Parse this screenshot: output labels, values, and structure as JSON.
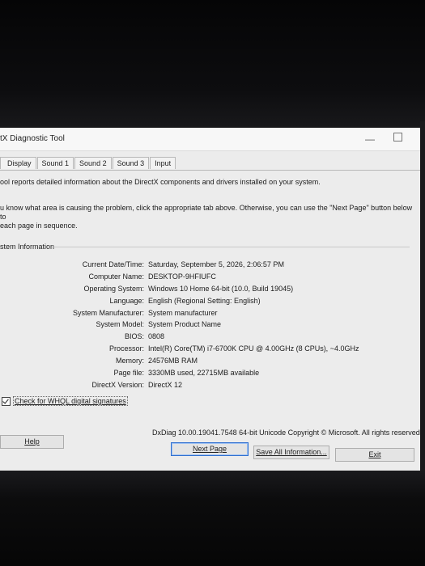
{
  "window": {
    "title": "tX Diagnostic Tool",
    "minimize_symbol": "—"
  },
  "tabs": [
    "Display",
    "Sound 1",
    "Sound 2",
    "Sound 3",
    "Input"
  ],
  "intro": {
    "line1": "ool reports detailed information about the DirectX components and drivers installed on your system.",
    "line2": "u know what area is causing the problem, click the appropriate tab above.  Otherwise, you can use the \"Next Page\" button below to",
    "line3": "each page in sequence."
  },
  "system_info": {
    "group_label": "stem Information",
    "rows": [
      {
        "label": "Current Date/Time:",
        "value": "Saturday, September 5, 2026, 2:06:57 PM"
      },
      {
        "label": "Computer Name:",
        "value": "DESKTOP-9HFIUFC"
      },
      {
        "label": "Operating System:",
        "value": "Windows 10 Home 64-bit (10.0, Build 19045)"
      },
      {
        "label": "Language:",
        "value": "English (Regional Setting: English)"
      },
      {
        "label": "System Manufacturer:",
        "value": "System manufacturer"
      },
      {
        "label": "System Model:",
        "value": "System Product Name"
      },
      {
        "label": "BIOS:",
        "value": "0808"
      },
      {
        "label": "Processor:",
        "value": "Intel(R) Core(TM) i7-6700K CPU @ 4.00GHz (8 CPUs), ~4.0GHz"
      },
      {
        "label": "Memory:",
        "value": "24576MB RAM"
      },
      {
        "label": "Page file:",
        "value": "3330MB used, 22715MB available"
      },
      {
        "label": "DirectX Version:",
        "value": "DirectX 12"
      }
    ]
  },
  "whql_checkbox": {
    "label": "Check for WHQL digital signatures",
    "checked": true
  },
  "copyright": "DxDiag 10.00.19041.7548 64-bit Unicode  Copyright © Microsoft. All rights reserved.",
  "buttons": {
    "help": "Help",
    "next_page": "Next Page",
    "save_all": "Save All Information...",
    "exit": "Exit"
  }
}
